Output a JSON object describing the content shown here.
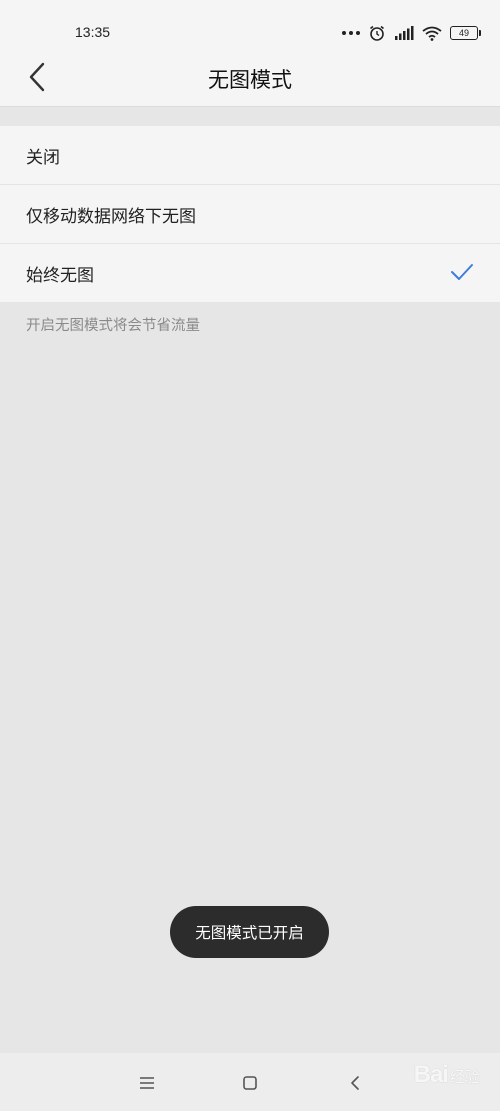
{
  "status_bar": {
    "time": "13:35",
    "battery_level": "49",
    "icons": [
      "more-dots-icon",
      "alarm-icon",
      "signal-icon",
      "wifi-icon",
      "battery-icon"
    ]
  },
  "header": {
    "title": "无图模式",
    "back_icon": "chevron-left-icon"
  },
  "options": [
    {
      "label": "关闭",
      "selected": false
    },
    {
      "label": "仅移动数据网络下无图",
      "selected": false
    },
    {
      "label": "始终无图",
      "selected": true
    }
  ],
  "hint": "开启无图模式将会节省流量",
  "toast": "无图模式已开启",
  "nav_bar": {
    "icons": [
      "menu-icon",
      "home-square-icon",
      "back-chevron-icon"
    ]
  },
  "watermark": {
    "brand": "Bai",
    "suffix": "经验"
  },
  "colors": {
    "accent": "#3c7fd6",
    "background": "#e6e6e6",
    "surface": "#f5f5f5",
    "toast_bg": "#2c2c2c",
    "hint_text": "#8a8a8a"
  }
}
